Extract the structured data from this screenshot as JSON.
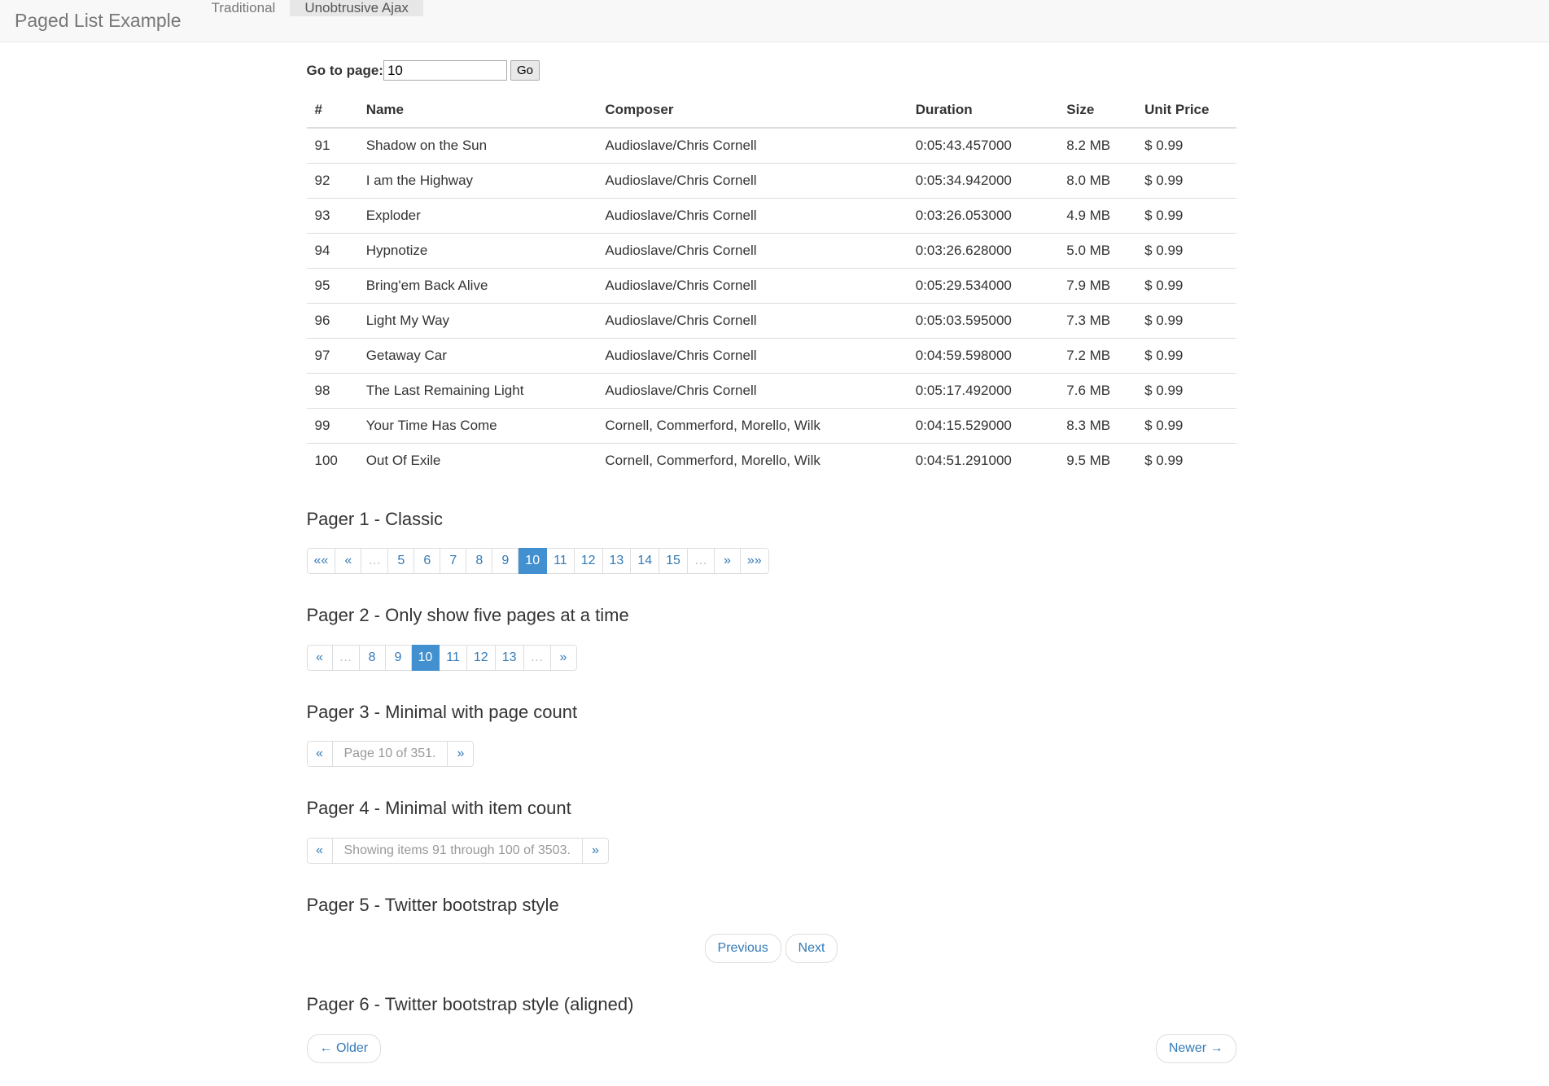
{
  "navbar": {
    "brand": "Paged List Example",
    "items": [
      {
        "label": "Traditional",
        "active": false
      },
      {
        "label": "Unobtrusive Ajax",
        "active": true
      }
    ]
  },
  "goto_form": {
    "label": "Go to page:",
    "value": "10",
    "placeholder": "",
    "button": "Go"
  },
  "table": {
    "headers": [
      "#",
      "Name",
      "Composer",
      "Duration",
      "Size",
      "Unit Price"
    ],
    "rows": [
      {
        "num": "91",
        "name": "Shadow on the Sun",
        "composer": "Audioslave/Chris Cornell",
        "duration": "0:05:43.457000",
        "size": "8.2 MB",
        "price": "$ 0.99"
      },
      {
        "num": "92",
        "name": "I am the Highway",
        "composer": "Audioslave/Chris Cornell",
        "duration": "0:05:34.942000",
        "size": "8.0 MB",
        "price": "$ 0.99"
      },
      {
        "num": "93",
        "name": "Exploder",
        "composer": "Audioslave/Chris Cornell",
        "duration": "0:03:26.053000",
        "size": "4.9 MB",
        "price": "$ 0.99"
      },
      {
        "num": "94",
        "name": "Hypnotize",
        "composer": "Audioslave/Chris Cornell",
        "duration": "0:03:26.628000",
        "size": "5.0 MB",
        "price": "$ 0.99"
      },
      {
        "num": "95",
        "name": "Bring'em Back Alive",
        "composer": "Audioslave/Chris Cornell",
        "duration": "0:05:29.534000",
        "size": "7.9 MB",
        "price": "$ 0.99"
      },
      {
        "num": "96",
        "name": "Light My Way",
        "composer": "Audioslave/Chris Cornell",
        "duration": "0:05:03.595000",
        "size": "7.3 MB",
        "price": "$ 0.99"
      },
      {
        "num": "97",
        "name": "Getaway Car",
        "composer": "Audioslave/Chris Cornell",
        "duration": "0:04:59.598000",
        "size": "7.2 MB",
        "price": "$ 0.99"
      },
      {
        "num": "98",
        "name": "The Last Remaining Light",
        "composer": "Audioslave/Chris Cornell",
        "duration": "0:05:17.492000",
        "size": "7.6 MB",
        "price": "$ 0.99"
      },
      {
        "num": "99",
        "name": "Your Time Has Come",
        "composer": "Cornell, Commerford, Morello, Wilk",
        "duration": "0:04:15.529000",
        "size": "8.3 MB",
        "price": "$ 0.99"
      },
      {
        "num": "100",
        "name": "Out Of Exile",
        "composer": "Cornell, Commerford, Morello, Wilk",
        "duration": "0:04:51.291000",
        "size": "9.5 MB",
        "price": "$ 0.99"
      }
    ]
  },
  "pagers": [
    {
      "heading": "Pager 1 - Classic",
      "items": [
        {
          "label": "««",
          "state": "link"
        },
        {
          "label": "«",
          "state": "link"
        },
        {
          "label": "…",
          "state": "ellipsis"
        },
        {
          "label": "5",
          "state": "link"
        },
        {
          "label": "6",
          "state": "link"
        },
        {
          "label": "7",
          "state": "link"
        },
        {
          "label": "8",
          "state": "link"
        },
        {
          "label": "9",
          "state": "link"
        },
        {
          "label": "10",
          "state": "active"
        },
        {
          "label": "11",
          "state": "link"
        },
        {
          "label": "12",
          "state": "link"
        },
        {
          "label": "13",
          "state": "link"
        },
        {
          "label": "14",
          "state": "link"
        },
        {
          "label": "15",
          "state": "link"
        },
        {
          "label": "…",
          "state": "ellipsis"
        },
        {
          "label": "»",
          "state": "link"
        },
        {
          "label": "»»",
          "state": "link"
        }
      ]
    },
    {
      "heading": "Pager 2 - Only show five pages at a time",
      "items": [
        {
          "label": "«",
          "state": "link"
        },
        {
          "label": "…",
          "state": "ellipsis"
        },
        {
          "label": "8",
          "state": "link"
        },
        {
          "label": "9",
          "state": "link"
        },
        {
          "label": "10",
          "state": "active"
        },
        {
          "label": "11",
          "state": "link"
        },
        {
          "label": "12",
          "state": "link"
        },
        {
          "label": "13",
          "state": "link"
        },
        {
          "label": "…",
          "state": "ellipsis"
        },
        {
          "label": "»",
          "state": "link"
        }
      ]
    },
    {
      "heading": "Pager 3 - Minimal with page count",
      "items": [
        {
          "label": "«",
          "state": "link"
        },
        {
          "label": "Page 10 of 351.",
          "state": "disabled-wide"
        },
        {
          "label": "»",
          "state": "link"
        }
      ]
    },
    {
      "heading": "Pager 4 - Minimal with item count",
      "items": [
        {
          "label": "«",
          "state": "link"
        },
        {
          "label": "Showing items 91 through 100 of 3503.",
          "state": "disabled-wide"
        },
        {
          "label": "»",
          "state": "link"
        }
      ]
    }
  ],
  "pager5": {
    "heading": "Pager 5 - Twitter bootstrap style",
    "previous": "Previous",
    "next": "Next"
  },
  "pager6": {
    "heading": "Pager 6 - Twitter bootstrap style (aligned)",
    "older": "← Older",
    "newer": "Newer →"
  },
  "colors": {
    "active_page": "#4290d0",
    "link": "#337ab7",
    "navbar_bg": "#f8f8f8",
    "navbar_active_tab": "#e7e7e7",
    "border": "#dddddd"
  }
}
